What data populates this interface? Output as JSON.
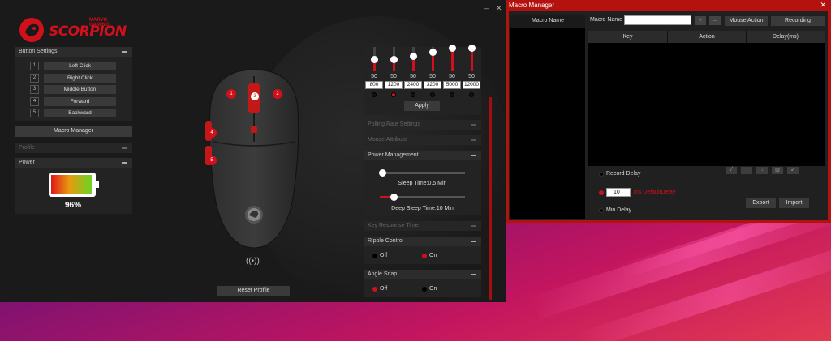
{
  "app": {
    "logo_small": "MARVO GAMING",
    "logo_main": "SCORPION",
    "window_controls": {
      "minimize": "–",
      "close": "✕"
    }
  },
  "button_settings": {
    "title": "Button Settings",
    "items": [
      {
        "num": "1",
        "label": "Left Click"
      },
      {
        "num": "2",
        "label": "Right Click"
      },
      {
        "num": "3",
        "label": "Middle Button"
      },
      {
        "num": "4",
        "label": "Forward"
      },
      {
        "num": "5",
        "label": "Backward"
      }
    ],
    "macro_manager_button": "Macro Manager"
  },
  "profile": {
    "title": "Profile"
  },
  "power": {
    "title": "Power",
    "battery_percent": "96%",
    "battery_level": 0.96
  },
  "mouse_markers": [
    "1",
    "2",
    "3",
    "4",
    "5"
  ],
  "reset_profile": "Reset Profile",
  "dpi": {
    "columns": [
      {
        "pct": "50",
        "value": "800",
        "level": 0.5,
        "active": false
      },
      {
        "pct": "50",
        "value": "1200",
        "level": 0.5,
        "active": true
      },
      {
        "pct": "50",
        "value": "2400",
        "level": 0.62,
        "active": false
      },
      {
        "pct": "50",
        "value": "3200",
        "level": 0.8,
        "active": false
      },
      {
        "pct": "50",
        "value": "5000",
        "level": 1.0,
        "active": false
      },
      {
        "pct": "50",
        "value": "12000",
        "level": 1.0,
        "active": false
      }
    ],
    "apply": "Apply"
  },
  "polling_rate": {
    "title": "Polling Rate Settings"
  },
  "mouse_attribute": {
    "title": "Mouse Attribute"
  },
  "power_management": {
    "title": "Power Management",
    "sleep_time": "Sleep Time:0.5 Min",
    "sleep_level": 0.03,
    "deep_sleep_time": "Deep Sleep Time:10 Min",
    "deep_sleep_level": 0.16
  },
  "key_response": {
    "title": "Key Response Time"
  },
  "ripple_control": {
    "title": "Ripple Control",
    "off": "Off",
    "on": "On",
    "selected": "On"
  },
  "angle_snap": {
    "title": "Angle Snap",
    "off": "Off",
    "on": "On",
    "selected": "Off"
  },
  "macro_manager": {
    "title": "Macro Manager",
    "close": "✕",
    "macro_name_header": "Macro Name",
    "macro_name_label": "Macro Name",
    "macro_name_value": "",
    "add_button": "+",
    "remove_button": "–",
    "mouse_action": "Mouse Action",
    "recording": "Recording",
    "columns": [
      "Key",
      "Action",
      "Delay(ms)"
    ],
    "record_delay": "Record Delay",
    "default_delay_value": "10",
    "default_delay_label": "ms DefaultDelay",
    "min_delay": "Min Delay",
    "delay_mode_selected": "DefaultDelay",
    "export": "Export",
    "import": "Import",
    "toolbar_icons": [
      "edit-icon",
      "arrow-up-icon",
      "arrow-down-icon",
      "delete-icon",
      "clear-icon"
    ]
  },
  "colors": {
    "accent": "#d0101a",
    "window_title": "#b3120f"
  }
}
